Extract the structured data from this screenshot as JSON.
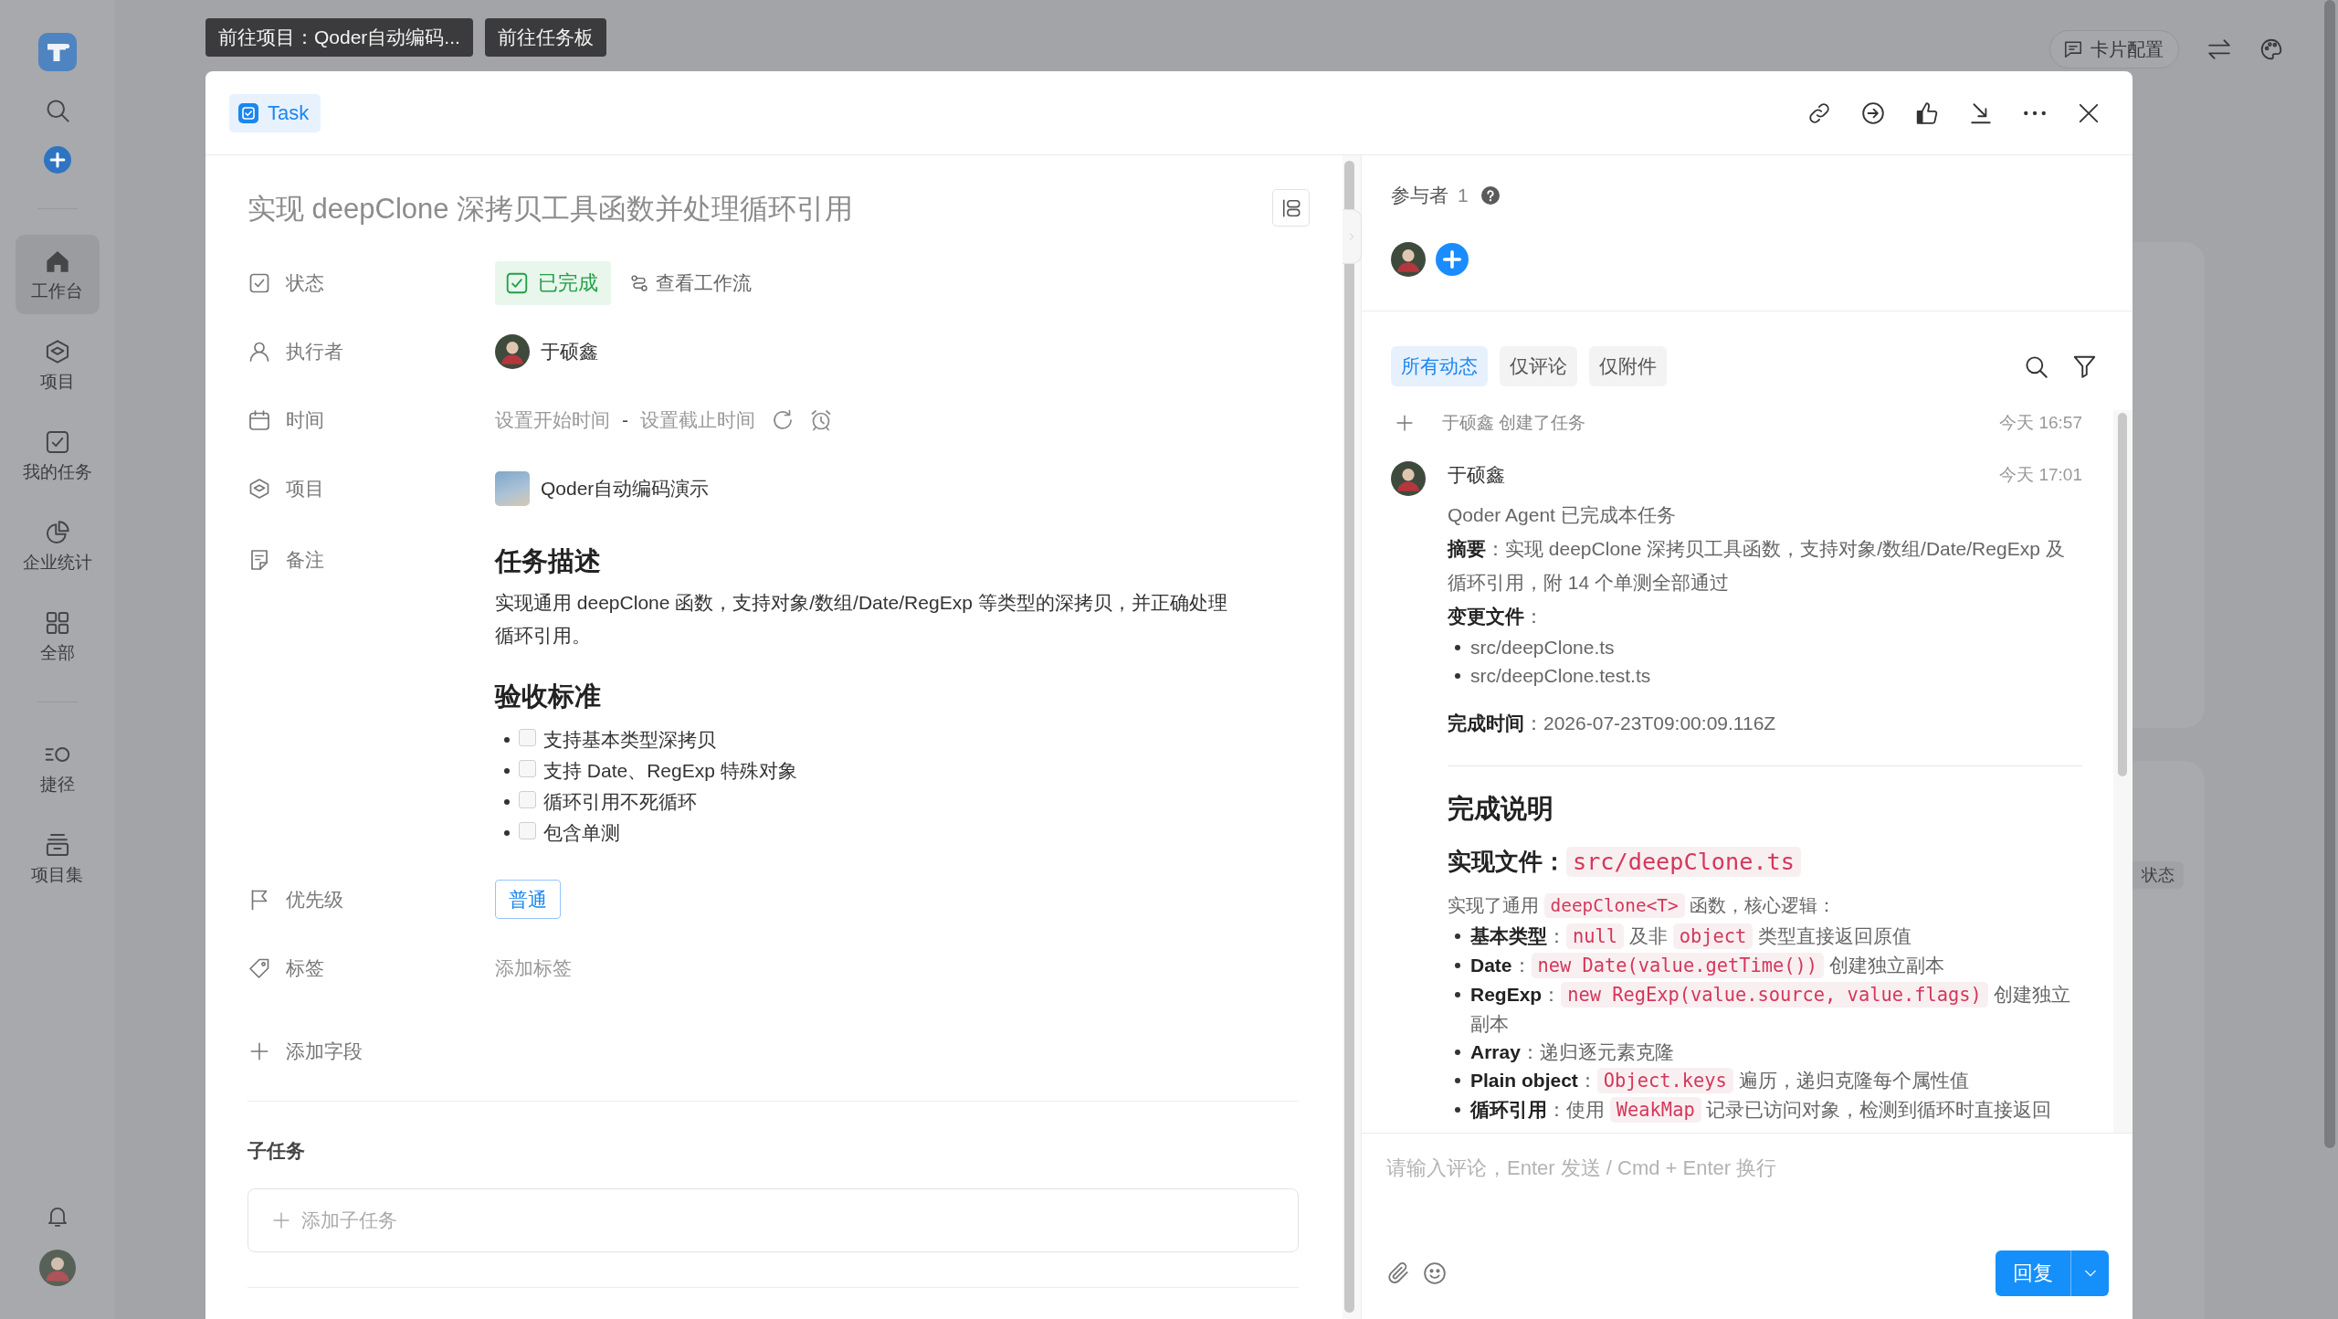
{
  "top_bar": {
    "jump_buttons": [
      "前往项目：Qoder自动编码...",
      "前往任务板"
    ],
    "card_config_button": "卡片配置"
  },
  "sidebar": {
    "nav_groups": [
      {
        "items": [
          {
            "label": "工作台",
            "selected": true
          },
          {
            "label": "项目",
            "selected": false
          },
          {
            "label": "我的任务",
            "selected": false
          },
          {
            "label": "企业统计",
            "selected": false
          },
          {
            "label": "全部",
            "selected": false
          }
        ]
      },
      {
        "items": [
          {
            "label": "捷径",
            "selected": false
          },
          {
            "label": "项目集",
            "selected": false
          }
        ]
      }
    ]
  },
  "background_board": {
    "card_tag": "状态"
  },
  "task": {
    "type_tag": "Task",
    "title": "实现 deepClone 深拷贝工具函数并处理循环引用",
    "fields": [
      {
        "kind": "status",
        "label": "状态",
        "value": "已完成",
        "done": true,
        "link": "查看工作流"
      },
      {
        "kind": "assignee",
        "label": "执行者",
        "value": "于硕鑫"
      },
      {
        "kind": "time",
        "label": "时间",
        "start": "设置开始时间",
        "separator": "-",
        "end": "设置截止时间"
      },
      {
        "kind": "project",
        "label": "项目",
        "value": "Qoder自动编码演示"
      },
      {
        "kind": "notes",
        "label": "备注",
        "blocks": [
          {
            "kind": "heading",
            "text": "任务描述"
          },
          {
            "kind": "paragraph",
            "text": "实现通用 deepClone 函数，支持对象/数组/Date/RegExp 等类型的深拷贝，并正确处理循环引用。"
          },
          {
            "kind": "heading",
            "text": "验收标准"
          },
          {
            "kind": "checklist",
            "items": [
              {
                "text": "支持基本类型深拷贝",
                "checked": false
              },
              {
                "text": "支持 Date、RegExp 特殊对象",
                "checked": false
              },
              {
                "text": "循环引用不死循环",
                "checked": false
              },
              {
                "text": "包含单测",
                "checked": false
              }
            ]
          }
        ]
      },
      {
        "kind": "priority",
        "label": "优先级",
        "value": "普通"
      },
      {
        "kind": "tags",
        "label": "标签",
        "action": "添加标签"
      }
    ],
    "add_field_button": "添加字段",
    "subtasks": {
      "title": "子任务",
      "add_button": "添加子任务"
    }
  },
  "activity": {
    "participants": {
      "label": "参与者",
      "count": "1"
    },
    "tabs": [
      {
        "label": "所有动态",
        "selected": true
      },
      {
        "label": "仅评论",
        "selected": false
      },
      {
        "label": "仅附件",
        "selected": false
      }
    ],
    "events": [
      {
        "kind": "system",
        "text": "于硕鑫 创建了任务",
        "time": "今天 16:57"
      },
      {
        "kind": "comment",
        "author": "于硕鑫",
        "time": "今天 17:01",
        "body": [
          {
            "kind": "paragraph",
            "text": "Qoder Agent 已完成本任务"
          },
          {
            "kind": "paragraph",
            "text": "**摘要**：实现 deepClone 深拷贝工具函数，支持对象/数组/Date/RegExp 及循环引用，附 14 个单测全部通过"
          },
          {
            "kind": "paragraph",
            "text": "**变更文件**："
          },
          {
            "kind": "list",
            "items": [
              {
                "parts": [
                  {
                    "kind": "text",
                    "text": "src/deepClone.ts"
                  }
                ]
              },
              {
                "parts": [
                  {
                    "kind": "text",
                    "text": "src/deepClone.test.ts"
                  }
                ]
              }
            ]
          },
          {
            "kind": "paragraph",
            "text": "**完成时间**：2026-07-23T09:00:09.116Z"
          },
          {
            "kind": "divider"
          },
          {
            "kind": "heading",
            "text": "完成说明"
          },
          {
            "kind": "subheading",
            "parts": [
              {
                "kind": "text",
                "text": "实现文件："
              },
              {
                "kind": "code",
                "text": "src/deepClone.ts"
              }
            ]
          },
          {
            "kind": "paragraph",
            "parts": [
              {
                "kind": "text",
                "text": "实现了通用 "
              },
              {
                "kind": "code",
                "text": "deepClone<T>"
              },
              {
                "kind": "text",
                "text": " 函数，核心逻辑："
              }
            ]
          },
          {
            "kind": "list",
            "items": [
              {
                "parts": [
                  {
                    "kind": "text",
                    "text": "**基本类型**："
                  },
                  {
                    "kind": "code",
                    "text": "null"
                  },
                  {
                    "kind": "text",
                    "text": " 及非 "
                  },
                  {
                    "kind": "code",
                    "text": "object"
                  },
                  {
                    "kind": "text",
                    "text": " 类型直接返回原值"
                  }
                ]
              },
              {
                "parts": [
                  {
                    "kind": "text",
                    "text": "**Date**："
                  },
                  {
                    "kind": "code",
                    "text": "new Date(value.getTime())"
                  },
                  {
                    "kind": "text",
                    "text": " 创建独立副本"
                  }
                ]
              },
              {
                "parts": [
                  {
                    "kind": "text",
                    "text": "**RegExp**："
                  },
                  {
                    "kind": "code",
                    "text": "new RegExp(value.source, value.flags)"
                  },
                  {
                    "kind": "text",
                    "text": " 创建独立副本"
                  }
                ]
              },
              {
                "parts": [
                  {
                    "kind": "text",
                    "text": "**Array**：递归逐元素克隆"
                  }
                ]
              },
              {
                "parts": [
                  {
                    "kind": "text",
                    "text": "**Plain object**："
                  },
                  {
                    "kind": "code",
                    "text": "Object.keys"
                  },
                  {
                    "kind": "text",
                    "text": " 遍历，递归克隆每个属性值"
                  }
                ]
              },
              {
                "parts": [
                  {
                    "kind": "text",
                    "text": "**循环引用**：使用 "
                  },
                  {
                    "kind": "code",
                    "text": "WeakMap"
                  },
                  {
                    "kind": "text",
                    "text": " 记录已访问对象，检测到循环时直接返回"
                  }
                ]
              }
            ]
          }
        ]
      }
    ],
    "composer": {
      "placeholder": "请输入评论，Enter 发送 / Cmd + Enter 换行",
      "reply_button": "回复"
    }
  }
}
